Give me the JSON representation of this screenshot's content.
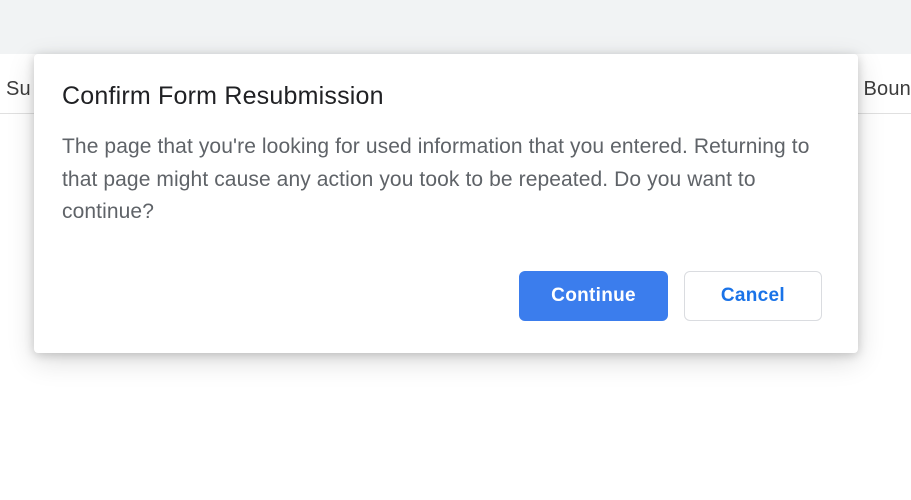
{
  "background": {
    "left_text": "Su",
    "right_text": "Boun"
  },
  "dialog": {
    "title": "Confirm Form Resubmission",
    "body": "The page that you're looking for used information that you entered. Returning to that page might cause any action you took to be repeated. Do you want to continue?",
    "continue_label": "Continue",
    "cancel_label": "Cancel"
  }
}
